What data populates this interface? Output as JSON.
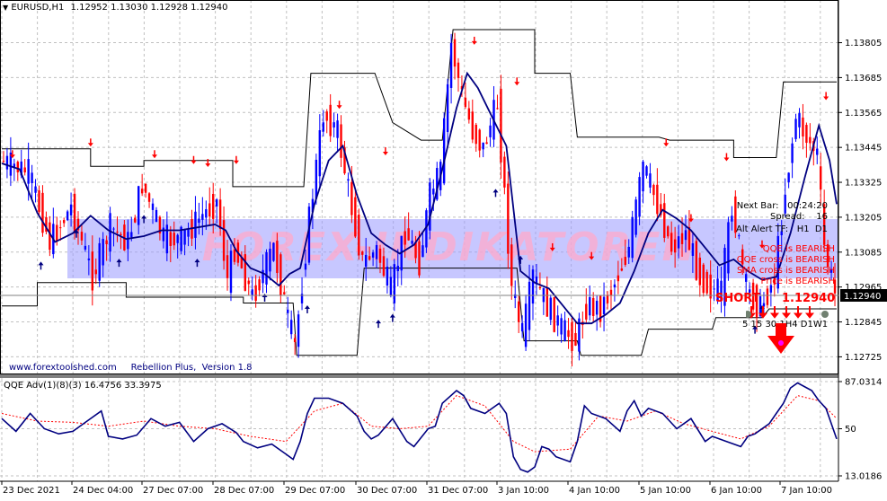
{
  "header": {
    "symbol": "EURUSD,H1",
    "ohlc": "1.12952 1.13030 1.12928 1.12940"
  },
  "watermark": "FOREX-INDIKATOREN",
  "footer_text": "www.forextoolshed.com     Rebellion Plus,  Version 1.8",
  "info_panel": {
    "next_bar": "Next Bar:   00:24:20",
    "spread": "Spread:    16",
    "alt_alert": "Alt Alert TF:   H1  D1",
    "signals": [
      "QQE is BEARISH",
      "QQE cross is BEARISH",
      "SMA cross is BEARISH",
      "Price is BEARISH"
    ],
    "short_label": "SHORT",
    "short_price": "1.12940",
    "tf_labels": [
      "5",
      "15",
      "30",
      "1H",
      "4",
      "D",
      "1W",
      "1"
    ],
    "tf_display": "5 15 30 1H4 D1W1"
  },
  "colors": {
    "bull": "#0000ff",
    "bear": "#ff0000",
    "ma_line": "#000080",
    "channel": "#000000",
    "watermark_band": "#9999ff",
    "watermark_text": "#ffaacc",
    "grid": "#c0c0c0",
    "signal_line": "#ff0000"
  },
  "chart_data": [
    {
      "type": "line",
      "subtype": "candlestick",
      "title": "EURUSD,H1",
      "y_axis": {
        "min": 1.1268,
        "max": 1.1389,
        "ticks": [
          "1.13805",
          "1.13685",
          "1.13565",
          "1.13445",
          "1.13325",
          "1.13205",
          "1.13085",
          "1.12965",
          "1.12845",
          "1.12725"
        ],
        "current_price_label": "1.12940"
      },
      "x_axis": {
        "labels": [
          "23 Dec 2021",
          "24 Dec 04:00",
          "27 Dec 07:00",
          "28 Dec 07:00",
          "29 Dec 07:00",
          "30 Dec 07:00",
          "31 Dec 07:00",
          "3 Jan 10:00",
          "4 Jan 10:00",
          "5 Jan 10:00",
          "6 Jan 10:00",
          "7 Jan 10:00"
        ]
      },
      "price_path": [
        [
          0,
          1.134
        ],
        [
          8,
          1.1336
        ],
        [
          14,
          1.1312
        ],
        [
          20,
          1.1324
        ],
        [
          26,
          1.13
        ],
        [
          31,
          1.1317
        ],
        [
          36,
          1.1312
        ],
        [
          40,
          1.1332
        ],
        [
          46,
          1.1313
        ],
        [
          51,
          1.1313
        ],
        [
          56,
          1.132
        ],
        [
          61,
          1.1326
        ],
        [
          64,
          1.1299
        ],
        [
          66,
          1.131
        ],
        [
          71,
          1.1293
        ],
        [
          77,
          1.131
        ],
        [
          81,
          1.1285
        ],
        [
          83,
          1.1276
        ],
        [
          87,
          1.132
        ],
        [
          91,
          1.1356
        ],
        [
          95,
          1.135
        ],
        [
          98,
          1.133
        ],
        [
          102,
          1.1305
        ],
        [
          106,
          1.1309
        ],
        [
          110,
          1.1295
        ],
        [
          114,
          1.1316
        ],
        [
          118,
          1.1305
        ],
        [
          121,
          1.1328
        ],
        [
          124,
          1.1336
        ],
        [
          127,
          1.138
        ],
        [
          130,
          1.1362
        ],
        [
          133,
          1.135
        ],
        [
          136,
          1.1344
        ],
        [
          140,
          1.136
        ],
        [
          144,
          1.1296
        ],
        [
          147,
          1.128
        ],
        [
          150,
          1.13
        ],
        [
          154,
          1.129
        ],
        [
          158,
          1.1282
        ],
        [
          162,
          1.1278
        ],
        [
          165,
          1.129
        ],
        [
          169,
          1.1289
        ],
        [
          173,
          1.1298
        ],
        [
          177,
          1.131
        ],
        [
          181,
          1.1338
        ],
        [
          185,
          1.1325
        ],
        [
          189,
          1.131
        ],
        [
          193,
          1.1315
        ],
        [
          197,
          1.13
        ],
        [
          200,
          1.1296
        ],
        [
          203,
          1.1295
        ],
        [
          206,
          1.1325
        ],
        [
          210,
          1.1296
        ],
        [
          214,
          1.1289
        ],
        [
          218,
          1.13
        ],
        [
          221,
          1.133
        ],
        [
          224,
          1.1355
        ],
        [
          227,
          1.1348
        ],
        [
          230,
          1.1342
        ],
        [
          232,
          1.131
        ],
        [
          235,
          1.1294
        ]
      ],
      "ma_path": [
        [
          0,
          1.1339
        ],
        [
          5,
          1.1337
        ],
        [
          10,
          1.1322
        ],
        [
          15,
          1.1312
        ],
        [
          20,
          1.1315
        ],
        [
          25,
          1.1321
        ],
        [
          30,
          1.1316
        ],
        [
          35,
          1.1313
        ],
        [
          40,
          1.1314
        ],
        [
          45,
          1.1316
        ],
        [
          50,
          1.1316
        ],
        [
          55,
          1.1317
        ],
        [
          60,
          1.1318
        ],
        [
          63,
          1.1316
        ],
        [
          66,
          1.1309
        ],
        [
          70,
          1.1303
        ],
        [
          74,
          1.1301
        ],
        [
          78,
          1.1297
        ],
        [
          81,
          1.1301
        ],
        [
          84,
          1.1303
        ],
        [
          88,
          1.1325
        ],
        [
          92,
          1.134
        ],
        [
          96,
          1.1345
        ],
        [
          100,
          1.1328
        ],
        [
          104,
          1.1315
        ],
        [
          108,
          1.1311
        ],
        [
          112,
          1.1308
        ],
        [
          116,
          1.1311
        ],
        [
          120,
          1.1318
        ],
        [
          124,
          1.1337
        ],
        [
          128,
          1.1358
        ],
        [
          131,
          1.137
        ],
        [
          134,
          1.1365
        ],
        [
          138,
          1.1355
        ],
        [
          142,
          1.1345
        ],
        [
          146,
          1.1302
        ],
        [
          150,
          1.1298
        ],
        [
          154,
          1.1296
        ],
        [
          158,
          1.129
        ],
        [
          162,
          1.1284
        ],
        [
          166,
          1.1284
        ],
        [
          170,
          1.1287
        ],
        [
          174,
          1.1291
        ],
        [
          178,
          1.1302
        ],
        [
          182,
          1.1315
        ],
        [
          186,
          1.1323
        ],
        [
          190,
          1.132
        ],
        [
          194,
          1.1316
        ],
        [
          198,
          1.131
        ],
        [
          202,
          1.1304
        ],
        [
          206,
          1.1306
        ],
        [
          210,
          1.1302
        ],
        [
          214,
          1.1299
        ],
        [
          218,
          1.13
        ],
        [
          222,
          1.1315
        ],
        [
          226,
          1.1334
        ],
        [
          230,
          1.1352
        ],
        [
          233,
          1.134
        ],
        [
          235,
          1.1325
        ]
      ],
      "channel_upper": [
        [
          0,
          1.1344
        ],
        [
          25,
          1.1344
        ],
        [
          25,
          1.1338
        ],
        [
          40,
          1.1338
        ],
        [
          40,
          1.134
        ],
        [
          65,
          1.134
        ],
        [
          65,
          1.1331
        ],
        [
          75,
          1.1331
        ],
        [
          75,
          1.1331
        ],
        [
          85,
          1.1331
        ],
        [
          87,
          1.137
        ],
        [
          105,
          1.137
        ],
        [
          110,
          1.1353
        ],
        [
          118,
          1.1347
        ],
        [
          124,
          1.1347
        ],
        [
          127,
          1.1385
        ],
        [
          150,
          1.1385
        ],
        [
          150,
          1.137
        ],
        [
          160,
          1.137
        ],
        [
          162,
          1.1348
        ],
        [
          185,
          1.1348
        ],
        [
          188,
          1.1347
        ],
        [
          206,
          1.1347
        ],
        [
          206,
          1.1341
        ],
        [
          218,
          1.1341
        ],
        [
          220,
          1.1367
        ],
        [
          235,
          1.1367
        ]
      ],
      "channel_lower": [
        [
          0,
          1.129
        ],
        [
          10,
          1.129
        ],
        [
          10,
          1.1298
        ],
        [
          35,
          1.1298
        ],
        [
          35,
          1.1293
        ],
        [
          68,
          1.1293
        ],
        [
          68,
          1.1291
        ],
        [
          82,
          1.1291
        ],
        [
          83,
          1.1273
        ],
        [
          100,
          1.1273
        ],
        [
          102,
          1.1303
        ],
        [
          120,
          1.1303
        ],
        [
          125,
          1.1303
        ],
        [
          145,
          1.1303
        ],
        [
          147,
          1.1278
        ],
        [
          162,
          1.1278
        ],
        [
          163,
          1.1273
        ],
        [
          180,
          1.1273
        ],
        [
          182,
          1.1282
        ],
        [
          200,
          1.1282
        ],
        [
          201,
          1.1286
        ],
        [
          214,
          1.1286
        ],
        [
          216,
          1.1289
        ],
        [
          235,
          1.1289
        ]
      ],
      "down_arrows": [
        [
          3,
          1.1342
        ],
        [
          25,
          1.1346
        ],
        [
          43,
          1.1342
        ],
        [
          54,
          1.134
        ],
        [
          58,
          1.1339
        ],
        [
          66,
          1.134
        ],
        [
          95,
          1.1359
        ],
        [
          108,
          1.1343
        ],
        [
          133,
          1.1381
        ],
        [
          145,
          1.1367
        ],
        [
          155,
          1.131
        ],
        [
          166,
          1.1307
        ],
        [
          187,
          1.1346
        ],
        [
          194,
          1.132
        ],
        [
          204,
          1.1341
        ],
        [
          214,
          1.1311
        ],
        [
          232,
          1.1362
        ]
      ],
      "up_arrows": [
        [
          11,
          1.1304
        ],
        [
          21,
          1.1315
        ],
        [
          33,
          1.1305
        ],
        [
          40,
          1.132
        ],
        [
          55,
          1.1305
        ],
        [
          74,
          1.1293
        ],
        [
          86,
          1.1289
        ],
        [
          106,
          1.1284
        ],
        [
          110,
          1.1286
        ],
        [
          139,
          1.1329
        ],
        [
          146,
          1.1306
        ],
        [
          212,
          1.1282
        ],
        [
          214,
          1.1289
        ]
      ]
    },
    {
      "type": "line",
      "title": "QQE Adv(1)(8)(3) 16.4756 33.3975",
      "y_axis": {
        "min": 13.0186,
        "max": 87.0314,
        "ticks": [
          "87.0314",
          "50",
          "13.0186"
        ]
      },
      "series": [
        {
          "name": "QQE",
          "values": [
            [
              0,
              58
            ],
            [
              4,
              48
            ],
            [
              8,
              62
            ],
            [
              12,
              50
            ],
            [
              16,
              46
            ],
            [
              20,
              48
            ],
            [
              24,
              56
            ],
            [
              28,
              64
            ],
            [
              30,
              44
            ],
            [
              34,
              42
            ],
            [
              38,
              45
            ],
            [
              42,
              58
            ],
            [
              46,
              52
            ],
            [
              50,
              55
            ],
            [
              54,
              40
            ],
            [
              58,
              50
            ],
            [
              62,
              54
            ],
            [
              66,
              47
            ],
            [
              68,
              40
            ],
            [
              72,
              35
            ],
            [
              76,
              38
            ],
            [
              80,
              30
            ],
            [
              82,
              26
            ],
            [
              84,
              40
            ],
            [
              86,
              62
            ],
            [
              88,
              74
            ],
            [
              92,
              74
            ],
            [
              96,
              70
            ],
            [
              100,
              60
            ],
            [
              102,
              48
            ],
            [
              104,
              42
            ],
            [
              106,
              45
            ],
            [
              110,
              58
            ],
            [
              114,
              40
            ],
            [
              116,
              36
            ],
            [
              120,
              50
            ],
            [
              122,
              52
            ],
            [
              124,
              70
            ],
            [
              128,
              80
            ],
            [
              130,
              76
            ],
            [
              132,
              66
            ],
            [
              136,
              62
            ],
            [
              140,
              70
            ],
            [
              142,
              62
            ],
            [
              144,
              28
            ],
            [
              146,
              18
            ],
            [
              148,
              16
            ],
            [
              150,
              20
            ],
            [
              152,
              36
            ],
            [
              154,
              34
            ],
            [
              156,
              28
            ],
            [
              160,
              24
            ],
            [
              162,
              40
            ],
            [
              164,
              68
            ],
            [
              166,
              62
            ],
            [
              170,
              58
            ],
            [
              174,
              48
            ],
            [
              176,
              64
            ],
            [
              178,
              72
            ],
            [
              180,
              60
            ],
            [
              182,
              66
            ],
            [
              186,
              62
            ],
            [
              190,
              50
            ],
            [
              194,
              58
            ],
            [
              198,
              40
            ],
            [
              200,
              44
            ],
            [
              204,
              40
            ],
            [
              208,
              36
            ],
            [
              210,
              44
            ],
            [
              212,
              46
            ],
            [
              216,
              54
            ],
            [
              218,
              62
            ],
            [
              220,
              70
            ],
            [
              222,
              82
            ],
            [
              224,
              86
            ],
            [
              228,
              80
            ],
            [
              230,
              72
            ],
            [
              232,
              66
            ],
            [
              235,
              42
            ]
          ]
        },
        {
          "name": "Signal",
          "values": [
            [
              0,
              62
            ],
            [
              10,
              56
            ],
            [
              20,
              55
            ],
            [
              30,
              52
            ],
            [
              40,
              56
            ],
            [
              50,
              52
            ],
            [
              60,
              50
            ],
            [
              70,
              44
            ],
            [
              80,
              40
            ],
            [
              88,
              64
            ],
            [
              96,
              70
            ],
            [
              104,
              52
            ],
            [
              112,
              50
            ],
            [
              120,
              52
            ],
            [
              128,
              76
            ],
            [
              136,
              68
            ],
            [
              144,
              40
            ],
            [
              150,
              32
            ],
            [
              160,
              34
            ],
            [
              168,
              60
            ],
            [
              176,
              56
            ],
            [
              184,
              64
            ],
            [
              192,
              54
            ],
            [
              200,
              48
            ],
            [
              208,
              42
            ],
            [
              216,
              52
            ],
            [
              224,
              76
            ],
            [
              230,
              72
            ],
            [
              235,
              58
            ]
          ]
        }
      ]
    }
  ]
}
